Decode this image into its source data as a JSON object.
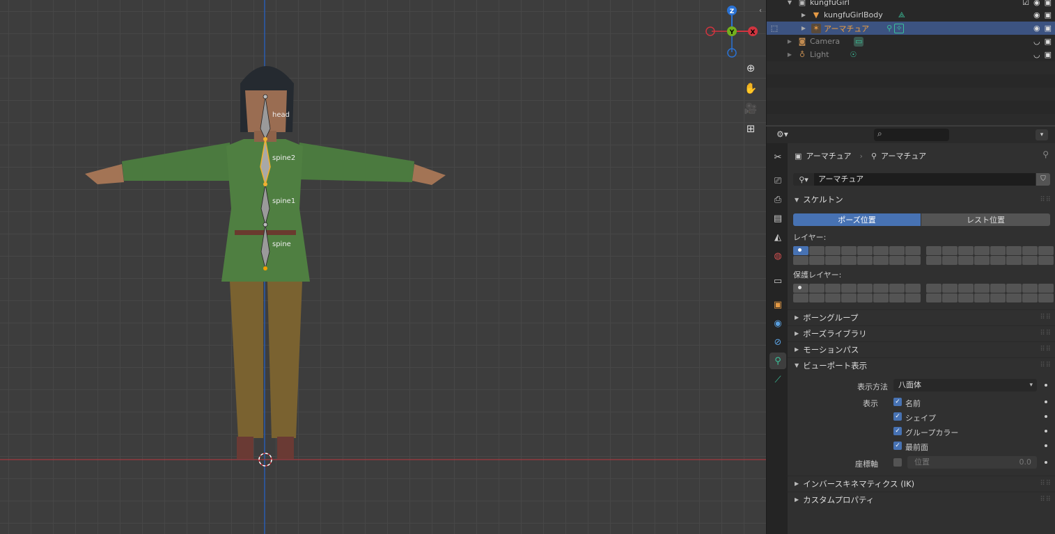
{
  "viewport": {
    "bones": [
      "head",
      "spine2",
      "spine1",
      "spine"
    ],
    "gizmo": {
      "z": "Z",
      "y": "Y",
      "x": "X"
    }
  },
  "outliner": {
    "rows": [
      {
        "label": "kungfuGirl"
      },
      {
        "label": "kungfuGirlBody"
      },
      {
        "label": "アーマチュア"
      },
      {
        "label": "Camera"
      },
      {
        "label": "Light"
      }
    ]
  },
  "properties": {
    "breadcrumb": {
      "object": "アーマチュア",
      "data": "アーマチュア"
    },
    "datablock_name": "アーマチュア",
    "skeleton": {
      "title": "スケルトン",
      "pose_position": "ポーズ位置",
      "rest_position": "レスト位置",
      "layers_label": "レイヤー:",
      "protected_layers_label": "保護レイヤー:"
    },
    "collapsed_panels": [
      "ボーングループ",
      "ポーズライブラリ",
      "モーションパス"
    ],
    "viewport_display": {
      "title": "ビューポート表示",
      "display_as_label": "表示方法",
      "display_as_value": "八面体",
      "show_label": "表示",
      "checks": [
        {
          "label": "名前",
          "checked": true
        },
        {
          "label": "シェイプ",
          "checked": true
        },
        {
          "label": "グループカラー",
          "checked": true
        },
        {
          "label": "最前面",
          "checked": true
        }
      ],
      "axes_label": "座標軸",
      "axes_position_label": "位置",
      "axes_position_value": "0.0"
    },
    "bottom_panels": [
      "インバースキネマティクス (IK)",
      "カスタムプロパティ"
    ]
  },
  "colors": {
    "accent": "#4772b3",
    "selected_row": "#3c5381",
    "bone_selected": "#f0b030",
    "x_axis": "#d0343f",
    "y_axis": "#72b01d",
    "z_axis": "#2a72d4"
  }
}
